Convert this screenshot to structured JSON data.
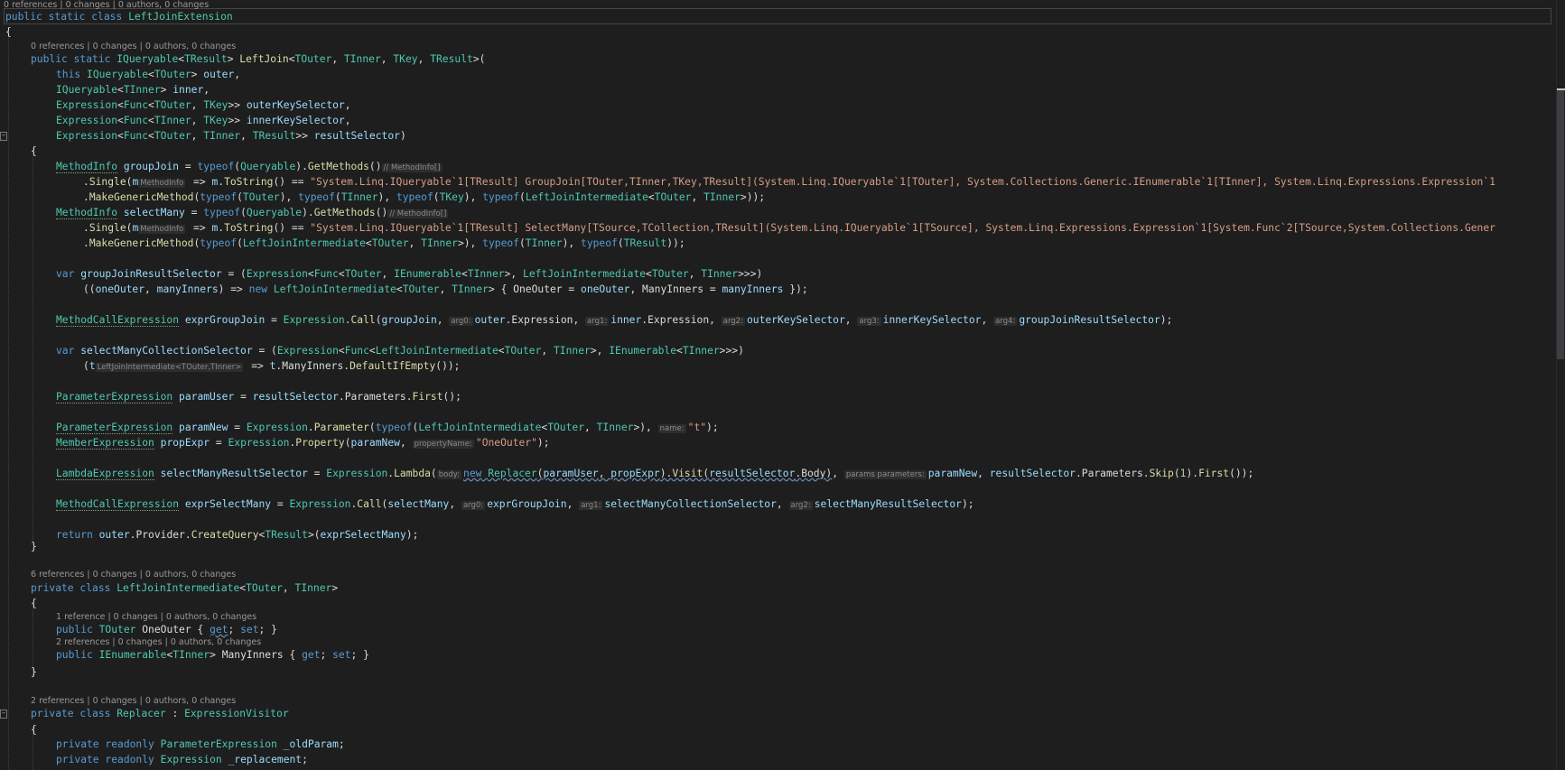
{
  "editor": {
    "lenses": {
      "class_top": "0 references | 0 changes | 0 authors, 0 changes",
      "left_join": "0 references | 0 changes | 0 authors, 0 changes",
      "intermediate": "6 references | 0 changes | 0 authors, 0 changes",
      "one_outer": "1 reference | 0 changes | 0 authors, 0 changes",
      "many_inners": "2 references | 0 changes | 0 authors, 0 changes",
      "replacer": "2 references | 0 changes | 0 authors, 0 changes"
    },
    "hints": {
      "methodinfo_arr": "// MethodInfo[]",
      "m_type": "MethodInfo",
      "arg0": "arg0:",
      "arg1": "arg1:",
      "arg2": "arg2:",
      "arg3": "arg3:",
      "arg4": "arg4:",
      "t_type": "LeftJoinIntermediate<TOuter,TInner>",
      "name": "name:",
      "property_name": "propertyName:",
      "body": "body:",
      "params": "params parameters:"
    },
    "strings": {
      "group_join_sig": "\"System.Linq.IQueryable`1[TResult] GroupJoin[TOuter,TInner,TKey,TResult](System.Linq.IQueryable`1[TOuter], System.Collections.Generic.IEnumerable`1[TInner], System.Linq.Expressions.Expression`1",
      "select_many_sig": "\"System.Linq.IQueryable`1[TResult] SelectMany[TSource,TCollection,TResult](System.Linq.IQueryable`1[TSource], System.Linq.Expressions.Expression`1[System.Func`2[TSource,System.Collections.Gener",
      "t": "\"t\"",
      "one_outer": "\"OneOuter\""
    },
    "numbers": {
      "one": "1"
    },
    "tokens": {
      "public": "public",
      "static": "static",
      "class": "class",
      "this": "this",
      "typeof": "typeof",
      "var": "var",
      "new": "new",
      "return": "return",
      "private": "private",
      "readonly": "readonly",
      "get": "get",
      "set": "set",
      "LeftJoinExtension": "LeftJoinExtension",
      "IQueryable": "IQueryable",
      "TResult": "TResult",
      "TOuter": "TOuter",
      "TInner": "TInner",
      "TKey": "TKey",
      "LeftJoin": "LeftJoin",
      "Expression": "Expression",
      "Func": "Func",
      "outer": "outer",
      "inner": "inner",
      "outerKeySelector": "outerKeySelector",
      "innerKeySelector": "innerKeySelector",
      "resultSelector": "resultSelector",
      "MethodInfo": "MethodInfo",
      "groupJoin": "groupJoin",
      "Queryable": "Queryable",
      "GetMethods": "GetMethods",
      "Single": "Single",
      "m": "m",
      "ToString": "ToString",
      "MakeGenericMethod": "MakeGenericMethod",
      "LeftJoinIntermediate": "LeftJoinIntermediate",
      "selectMany": "selectMany",
      "groupJoinResultSelector": "groupJoinResultSelector",
      "IEnumerable": "IEnumerable",
      "oneOuter": "oneOuter",
      "manyInners": "manyInners",
      "OneOuter": "OneOuter",
      "ManyInners": "ManyInners",
      "MethodCallExpression": "MethodCallExpression",
      "exprGroupJoin": "exprGroupJoin",
      "Call": "Call",
      "selectManyCollectionSelector": "selectManyCollectionSelector",
      "t": "t",
      "DefaultIfEmpty": "DefaultIfEmpty",
      "ParameterExpression": "ParameterExpression",
      "paramUser": "paramUser",
      "Parameters": "Parameters",
      "First": "First",
      "paramNew": "paramNew",
      "Parameter": "Parameter",
      "MemberExpression": "MemberExpression",
      "propExpr": "propExpr",
      "Property": "Property",
      "LambdaExpression": "LambdaExpression",
      "selectManyResultSelector": "selectManyResultSelector",
      "Lambda": "Lambda",
      "Replacer": "Replacer",
      "Visit": "Visit",
      "Body": "Body",
      "Skip": "Skip",
      "exprSelectMany": "exprSelectMany",
      "Provider": "Provider",
      "CreateQuery": "CreateQuery",
      "ExpressionVisitor": "ExpressionVisitor",
      "_oldParam": "_oldParam",
      "_replacement": "_replacement"
    }
  }
}
